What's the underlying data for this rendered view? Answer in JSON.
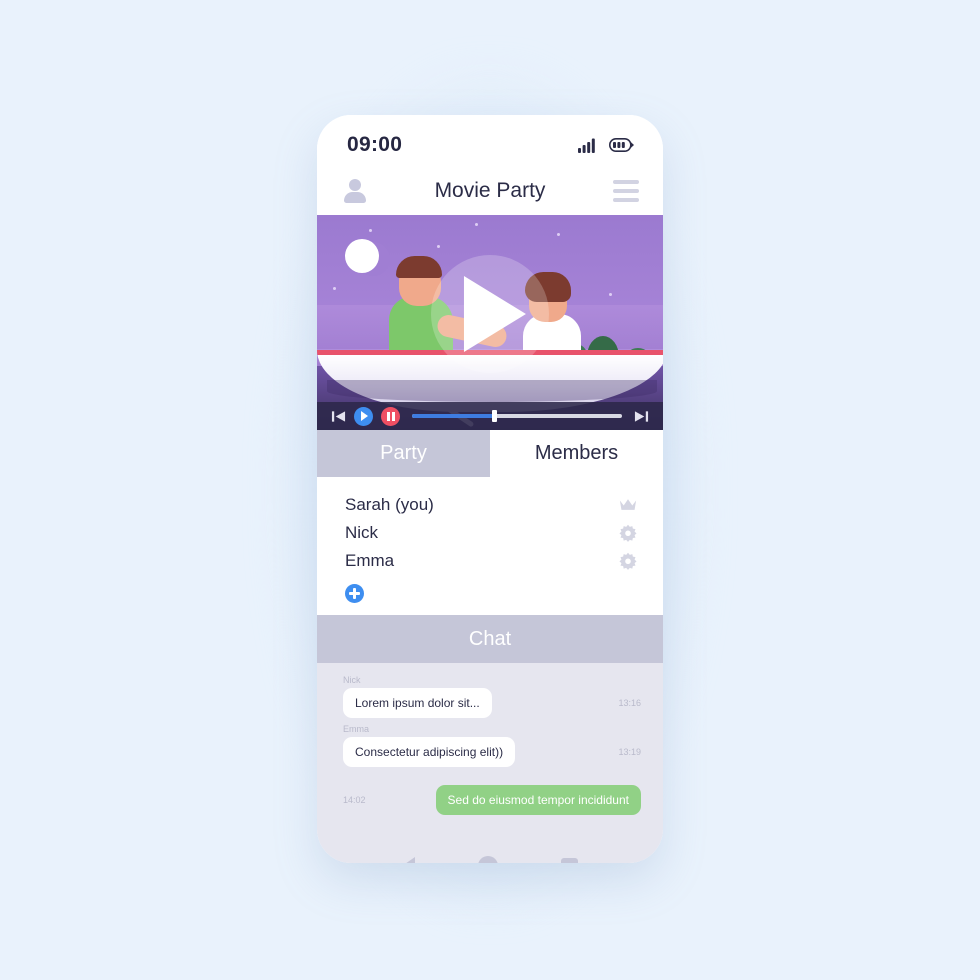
{
  "statusbar": {
    "time": "09:00",
    "signal_icon": "signal-bars-icon",
    "battery_icon": "battery-icon"
  },
  "header": {
    "title": "Movie Party",
    "profile_icon": "user-avatar-icon",
    "menu_icon": "hamburger-menu-icon"
  },
  "video": {
    "play_overlay_icon": "play-overlay-icon",
    "scene_alt": "couple rowing a boat at night",
    "controls": {
      "prev_label": "prev-track-icon",
      "play_label": "play-icon",
      "pause_label": "pause-icon",
      "next_label": "next-track-icon",
      "progress_percent": 39
    }
  },
  "tabs": [
    {
      "label": "Party",
      "active": false
    },
    {
      "label": "Members",
      "active": true
    }
  ],
  "members": {
    "list": [
      {
        "name": "Sarah (you)",
        "icon": "crown-icon"
      },
      {
        "name": "Nick",
        "icon": "gear-icon"
      },
      {
        "name": "Emma",
        "icon": "gear-icon"
      }
    ],
    "add_label": "add-member-icon"
  },
  "chat": {
    "header": "Chat",
    "messages": [
      {
        "author": "Nick",
        "text": "Lorem ipsum dolor sit...",
        "time": "13:16",
        "outgoing": false
      },
      {
        "author": "Emma",
        "text": "Consectetur adipiscing elit))",
        "time": "13:19",
        "outgoing": false
      },
      {
        "author": "",
        "text": "Sed do eiusmod tempor incididunt",
        "time": "14:02",
        "outgoing": true
      }
    ]
  },
  "navbar": {
    "back": "back-nav-icon",
    "home": "home-nav-icon",
    "recents": "recents-nav-icon"
  },
  "colors": {
    "accent_blue": "#3e8ef0",
    "pause_red": "#ef4f63",
    "tab_inactive": "#c5c6d8",
    "bubble_green": "#91d186",
    "title_dark": "#2b2c47"
  }
}
